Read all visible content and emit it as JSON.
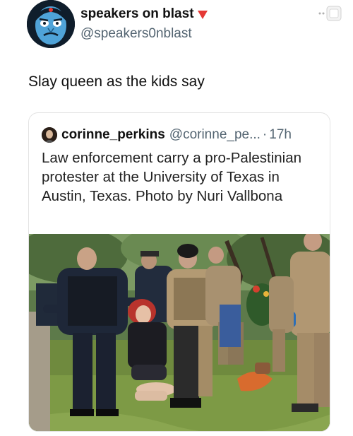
{
  "author": {
    "display_name": "speakers on blast",
    "handle": "@speakers0nblast",
    "badge_color": "#e53935"
  },
  "tweet": {
    "text": "Slay queen as the kids say"
  },
  "quote": {
    "author_name": "corinne_perkins",
    "author_handle": "@corinne_pe...",
    "separator": "·",
    "time": "17h",
    "text": "Law enforcement carry a pro-Palestinian protester at the University of Texas in Austin, Texas. Photo by Nuri Vallbona"
  },
  "icons": {
    "avatar": "cartoon-face-avatar",
    "more": "more-options-icon",
    "badge": "red-triangle-icon"
  }
}
